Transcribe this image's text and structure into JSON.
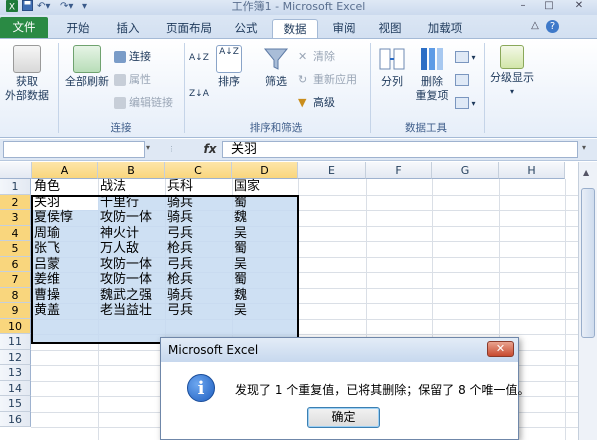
{
  "window": {
    "title": "工作簿1 - Microsoft Excel",
    "min_label": "–",
    "max_label": "□",
    "close_label": "✕",
    "help_label": "?",
    "ribbon_min_label": "△"
  },
  "tabs": [
    "文件",
    "开始",
    "插入",
    "页面布局",
    "公式",
    "数据",
    "审阅",
    "视图",
    "加载项"
  ],
  "ribbon": {
    "get_external": "获取\n外部数据",
    "refresh_all": "全部刷新",
    "connections": "连接",
    "properties": "属性",
    "edit_links": "编辑链接",
    "group_connections": "连接",
    "sort_az": "A↓Z",
    "sort": "排序",
    "filter": "筛选",
    "clear": "清除",
    "reapply": "重新应用",
    "advanced": "高级",
    "group_sort_filter": "排序和筛选",
    "text_to_columns": "分列",
    "remove_duplicates": "删除\n重复项",
    "group_data_tools": "数据工具",
    "outline": "分级显示"
  },
  "formula_bar": {
    "name_box": "",
    "fx": "fx",
    "content": "关羽"
  },
  "columns": [
    "A",
    "B",
    "C",
    "D",
    "E",
    "F",
    "G",
    "H"
  ],
  "rows": [
    "1",
    "2",
    "3",
    "4",
    "5",
    "6",
    "7",
    "8",
    "9",
    "10",
    "11",
    "12",
    "13",
    "14",
    "15",
    "16"
  ],
  "cells": [
    [
      "角色",
      "战法",
      "兵科",
      "国家"
    ],
    [
      "关羽",
      "千里行",
      "骑兵",
      "蜀"
    ],
    [
      "夏侯惇",
      "攻防一体",
      "骑兵",
      "魏"
    ],
    [
      "周瑜",
      "神火计",
      "弓兵",
      "吴"
    ],
    [
      "张飞",
      "万人敌",
      "枪兵",
      "蜀"
    ],
    [
      "吕蒙",
      "攻防一体",
      "弓兵",
      "吴"
    ],
    [
      "姜维",
      "攻防一体",
      "枪兵",
      "蜀"
    ],
    [
      "曹操",
      "魏武之强",
      "骑兵",
      "魏"
    ],
    [
      "黄盖",
      "老当益壮",
      "弓兵",
      "吴"
    ]
  ],
  "dialog": {
    "title": "Microsoft Excel",
    "close": "✕",
    "message": "发现了 1 个重复值，已将其删除；保留了 8 个唯一值。",
    "ok": "确定",
    "icon": "info-icon"
  }
}
